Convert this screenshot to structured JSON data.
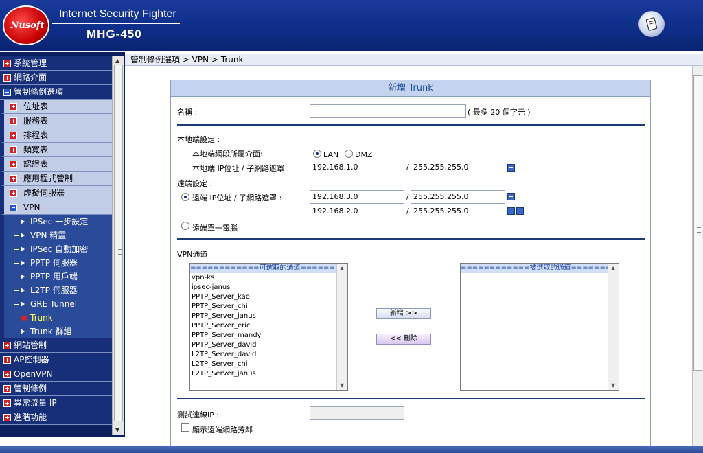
{
  "header": {
    "brand": "Nusoft",
    "product": "Internet Security Fighter",
    "model": "MHG-450",
    "help_icon": "note-pad-icon"
  },
  "sidebar": {
    "items": [
      {
        "label": "系統管理",
        "level": 1,
        "state": "collapsed"
      },
      {
        "label": "網路介面",
        "level": 1,
        "state": "collapsed"
      },
      {
        "label": "管制條例選項",
        "level": 1,
        "state": "expanded"
      },
      {
        "label": "位址表",
        "level": 2,
        "state": "collapsed"
      },
      {
        "label": "服務表",
        "level": 2,
        "state": "collapsed"
      },
      {
        "label": "排程表",
        "level": 2,
        "state": "collapsed"
      },
      {
        "label": "頻寬表",
        "level": 2,
        "state": "collapsed"
      },
      {
        "label": "認證表",
        "level": 2,
        "state": "collapsed"
      },
      {
        "label": "應用程式管制",
        "level": 2,
        "state": "collapsed"
      },
      {
        "label": "虛擬伺服器",
        "level": 2,
        "state": "collapsed"
      },
      {
        "label": "VPN",
        "level": 2,
        "state": "expanded"
      },
      {
        "label": "IPSec 一步設定",
        "level": 3
      },
      {
        "label": "VPN 精靈",
        "level": 3
      },
      {
        "label": "IPSec 自動加密",
        "level": 3
      },
      {
        "label": "PPTP 伺服器",
        "level": 3
      },
      {
        "label": "PPTP 用戶端",
        "level": 3
      },
      {
        "label": "L2TP 伺服器",
        "level": 3
      },
      {
        "label": "GRE Tunnel",
        "level": 3
      },
      {
        "label": "Trunk",
        "level": 3,
        "active": true
      },
      {
        "label": "Trunk 群組",
        "level": 3
      },
      {
        "label": "網站管制",
        "level": 1,
        "state": "collapsed"
      },
      {
        "label": "AP控制器",
        "level": 1,
        "state": "collapsed"
      },
      {
        "label": "OpenVPN",
        "level": 1,
        "state": "collapsed"
      },
      {
        "label": "管制條例",
        "level": 1,
        "state": "collapsed"
      },
      {
        "label": "異常流量 IP",
        "level": 1,
        "state": "collapsed"
      },
      {
        "label": "進階功能",
        "level": 1,
        "state": "collapsed"
      }
    ]
  },
  "breadcrumb": "管制條例選項 > VPN > Trunk",
  "form": {
    "title": "新增 Trunk",
    "name_label": "名稱 :",
    "name_value": "",
    "name_hint": "( 最多 20 個字元 )",
    "local_section": "本地端設定 :",
    "local_iface_label": "本地端網段所屬介面:",
    "iface_lan": "LAN",
    "iface_dmz": "DMZ",
    "iface_selected": "LAN",
    "local_ip_label": "本地端 IP位址 / 子網路遮罩 :",
    "local_ip": "192.168.1.0",
    "local_mask": "255.255.255.0",
    "slash": "/",
    "remote_section": "遠端設定 :",
    "remote_ip_label": "遠端 IP位址 / 子網路遮罩 :",
    "remote_entries": [
      {
        "ip": "192.168.3.0",
        "mask": "255.255.255.0"
      },
      {
        "ip": "192.168.2.0",
        "mask": "255.255.255.0"
      }
    ],
    "remote_single_label": "遠端單一電腦",
    "vpn_section": "VPN通道",
    "available_header": "============可選取的通道============",
    "available_tunnels": [
      "vpn-ks",
      "ipsec-janus",
      "PPTP_Server_kao",
      "PPTP_Server_chi",
      "PPTP_Server_janus",
      "PPTP_Server_eric",
      "PPTP_Server_mandy",
      "PPTP_Server_david",
      "L2TP_Server_david",
      "L2TP_Server_chi",
      "L2TP_Server_janus"
    ],
    "selected_header": "============被選取的通道============",
    "add_button": "新增 >>",
    "remove_button": "<< 刪除",
    "test_ip_label": "測試連線IP :",
    "test_ip_value": "",
    "show_remote_label": "顯示遠端網路芳鄰"
  }
}
